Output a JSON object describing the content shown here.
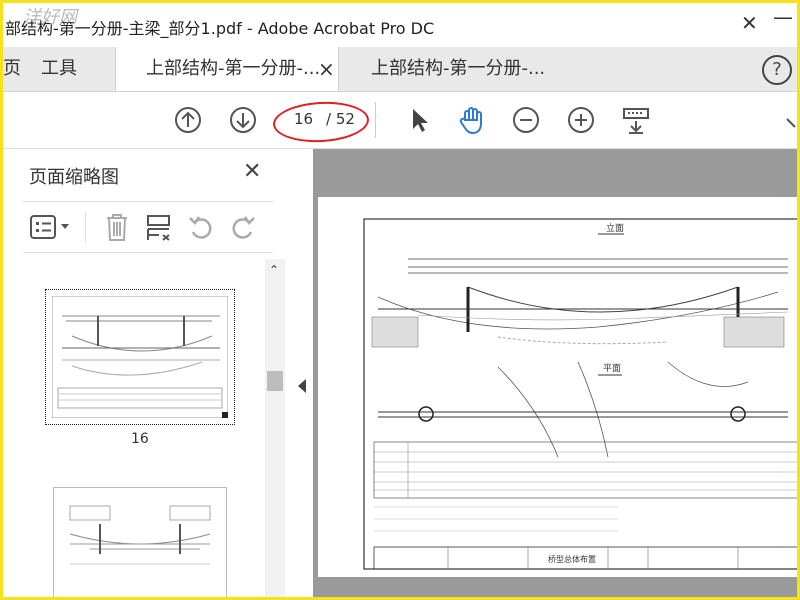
{
  "window": {
    "title": "部结构-第一分册-主梁_部分1.pdf - Adobe Acrobat Pro DC",
    "watermark": "洋好网",
    "close_glyph": "✕",
    "minimize_glyph": "—"
  },
  "tabs": {
    "home_partial": "页",
    "tools": "工具",
    "doc1": "上部结构-第一分册-...",
    "doc1_close": "×",
    "doc2": "上部结构-第一分册-...",
    "help": "?"
  },
  "toolbar": {
    "current_page": "16",
    "total_pages": "/ 52"
  },
  "panel": {
    "title": "页面缩略图",
    "close": "✕",
    "thumb_label": "16"
  },
  "colors": {
    "accent": "#2f79d6",
    "oval": "#e02020",
    "frame": "#f3e21c",
    "viewer_bg": "#9a9a9a"
  },
  "sheet": {
    "title_elevation": "立面",
    "title_plan": "平面",
    "caption": "桥型总体布置"
  }
}
